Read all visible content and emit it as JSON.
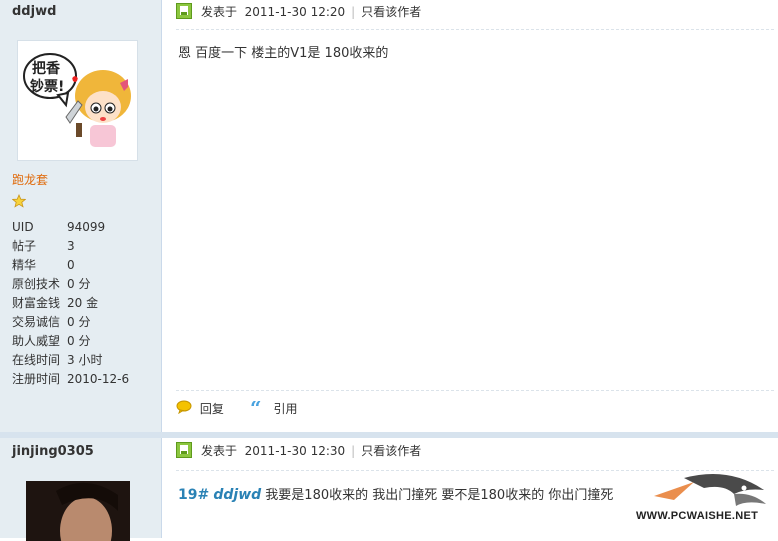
{
  "posts": [
    {
      "username": "ddjwd",
      "avatar_caption": "把香钞票!",
      "rank_title": "跑龙套",
      "stats": [
        {
          "k": "UID",
          "v": "94099"
        },
        {
          "k": "帖子",
          "v": "3"
        },
        {
          "k": "精华",
          "v": "0"
        },
        {
          "k": "原创技术",
          "v": "0 分"
        },
        {
          "k": "财富金钱",
          "v": "20 金"
        },
        {
          "k": "交易诚信",
          "v": "0 分"
        },
        {
          "k": "助人威望",
          "v": "0 分"
        },
        {
          "k": "在线时间",
          "v": "3 小时"
        },
        {
          "k": "注册时间",
          "v": "2010-12-6"
        }
      ],
      "posted_label": "发表于",
      "posted_time": "2011-1-30 12:20",
      "only_author": "只看该作者",
      "content": "恩  百度一下  楼主的V1是  180收来的",
      "reply_label": "回复",
      "quote_label": "引用"
    },
    {
      "username": "jinjing0305",
      "posted_label": "发表于",
      "posted_time": "2011-1-30 12:30",
      "only_author": "只看该作者",
      "floor": "19#",
      "quoted_user": "ddjwd",
      "content": "我要是180收来的    我出门撞死    要不是180收来的    你出门撞死"
    }
  ],
  "watermark": "WWW.PCWAISHE.NET",
  "colors": {
    "sidebar": "#e5edf2",
    "rank": "#e06a0a",
    "link": "#2a82b5",
    "icon_green": "#8cc63f"
  }
}
